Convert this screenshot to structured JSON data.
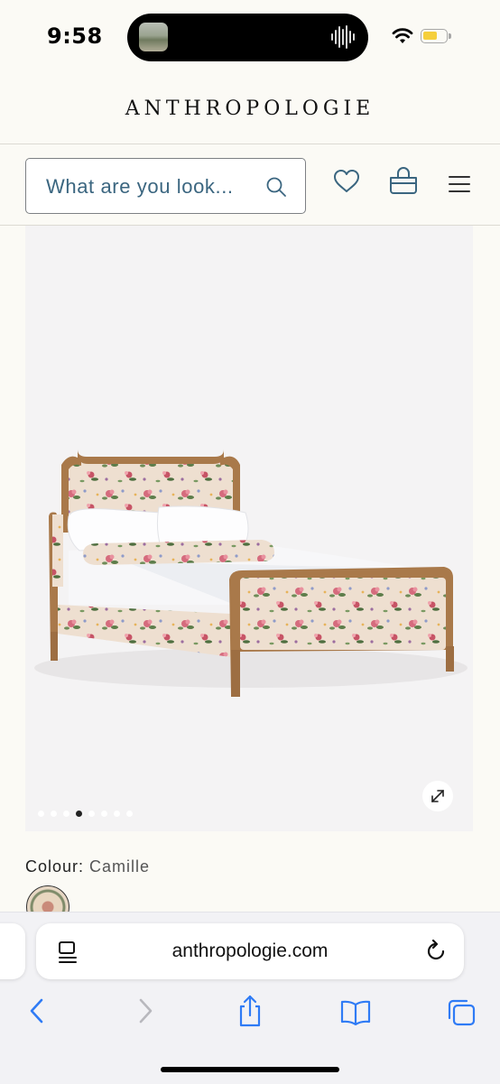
{
  "status_bar": {
    "time": "9:58",
    "icons": [
      "now-playing-thumbnail",
      "audio-waveform-icon",
      "wifi-icon",
      "battery-icon"
    ],
    "battery_level": 0.5,
    "battery_color": "#f5cf3c"
  },
  "header": {
    "logo": "ANTHROPOLOGIE",
    "search": {
      "placeholder": "What are you look..."
    },
    "icons": [
      "search-icon",
      "heart-icon",
      "basket-icon",
      "menu-icon"
    ],
    "accent_color": "#3b6680"
  },
  "product": {
    "image": "floral-upholstered-bed",
    "carousel": {
      "count": 8,
      "active_index": 3
    },
    "expand_icon": "expand-icon",
    "colour_label": "Colour:",
    "colour_value": "Camille"
  },
  "browser": {
    "url": "anthropologie.com",
    "icons": [
      "page-menu-icon",
      "reload-icon",
      "back-icon",
      "forward-icon",
      "share-icon",
      "bookmarks-icon",
      "tabs-icon"
    ],
    "accent_color": "#2f7bf5"
  }
}
